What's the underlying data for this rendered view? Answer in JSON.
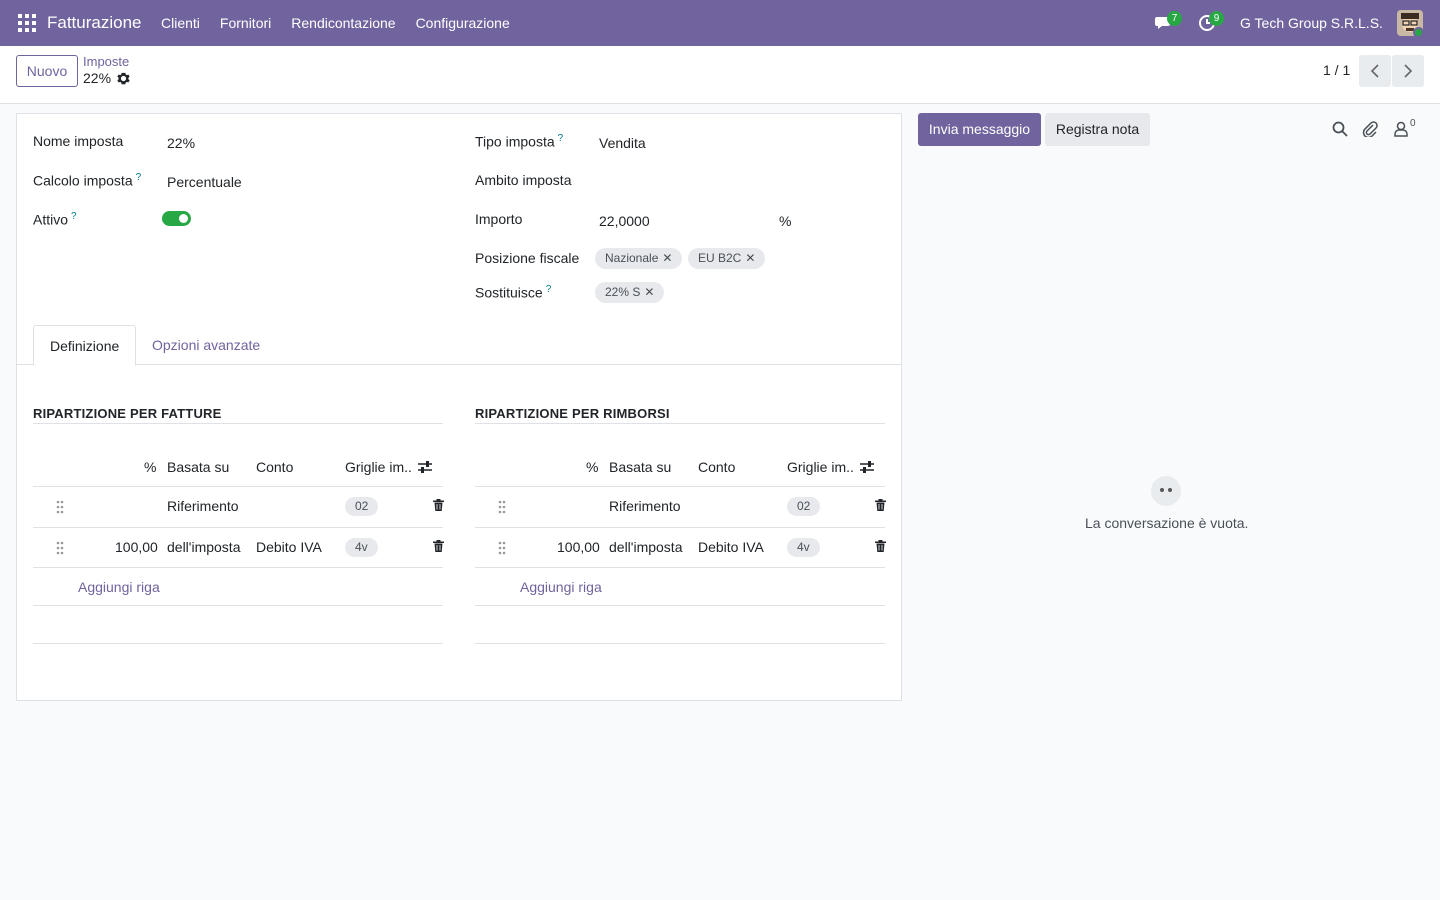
{
  "navbar": {
    "app_name": "Fatturazione",
    "menu": [
      "Clienti",
      "Fornitori",
      "Rendicontazione",
      "Configurazione"
    ],
    "messages_count": "7",
    "activities_count": "9",
    "company": "G Tech Group S.R.L.S.",
    "colors": {
      "brand": "#71639e",
      "badge": "#28a745"
    }
  },
  "control": {
    "new_button": "Nuovo",
    "breadcrumb": "Imposte",
    "record_name": "22%",
    "pager": "1 / 1"
  },
  "form": {
    "fields_left": [
      {
        "label": "Nome imposta",
        "help": "",
        "value": "22%"
      },
      {
        "label": "Calcolo imposta",
        "help": "?",
        "value": "Percentuale"
      },
      {
        "label": "Attivo",
        "help": "?",
        "value": ""
      }
    ],
    "active": true,
    "fields_right": [
      {
        "label": "Tipo imposta",
        "help": "?",
        "value": "Vendita"
      },
      {
        "label": "Ambito imposta",
        "help": "",
        "value": ""
      },
      {
        "label": "Importo",
        "help": "",
        "value": "22,0000",
        "unit": "%"
      },
      {
        "label": "Posizione fiscale",
        "help": "",
        "tags": [
          "Nazionale",
          "EU B2C"
        ]
      },
      {
        "label": "Sostituisce",
        "help": "?",
        "tags": [
          "22% S"
        ]
      }
    ],
    "tag_remove": "✕",
    "tabs": [
      "Definizione",
      "Opzioni avanzate"
    ],
    "sections": [
      {
        "title": "RIPARTIZIONE PER FATTURE",
        "columns": [
          "%",
          "Basata su",
          "Conto",
          "Griglie im.."
        ],
        "rows": [
          {
            "percent": "",
            "based_on": "Riferimento",
            "account": "",
            "grid": "02"
          },
          {
            "percent": "100,00",
            "based_on": "dell'imposta",
            "account": "Debito IVA",
            "grid": "4v"
          }
        ],
        "add_line": "Aggiungi riga"
      },
      {
        "title": "RIPARTIZIONE PER RIMBORSI",
        "columns": [
          "%",
          "Basata su",
          "Conto",
          "Griglie im.."
        ],
        "rows": [
          {
            "percent": "",
            "based_on": "Riferimento",
            "account": "",
            "grid": "02"
          },
          {
            "percent": "100,00",
            "based_on": "dell'imposta",
            "account": "Debito IVA",
            "grid": "4v"
          }
        ],
        "add_line": "Aggiungi riga"
      }
    ]
  },
  "chatter": {
    "send_message": "Invia messaggio",
    "log_note": "Registra nota",
    "followers_count": "0",
    "empty_text": "La conversazione è vuota."
  }
}
